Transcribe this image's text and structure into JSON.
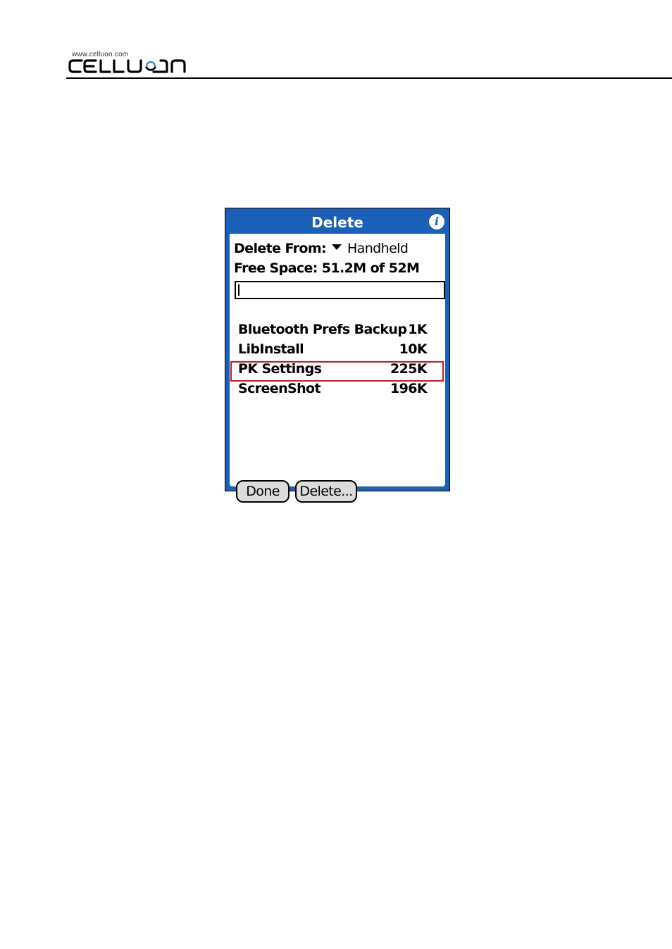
{
  "header": {
    "logo_url": "www.celluon.com",
    "logo_text": "CELLUON"
  },
  "dialog": {
    "title": "Delete",
    "delete_from_label": "Delete From:",
    "delete_from_value": "Handheld",
    "free_space": "Free Space: 51.2M of 52M",
    "search_value": "",
    "apps": [
      {
        "name": "Bluetooth Prefs Backup",
        "size": "1K"
      },
      {
        "name": "LibInstall",
        "size": "10K"
      },
      {
        "name": "PK Settings",
        "size": "225K"
      },
      {
        "name": "ScreenShot",
        "size": "196K"
      }
    ],
    "highlighted_app": "PK Settings",
    "buttons": {
      "done": "Done",
      "delete": "Delete..."
    }
  },
  "colors": {
    "title_bar": "#1a5fb8",
    "highlight": "#e0161c"
  },
  "icons": {
    "info": "info-icon",
    "dropdown": "triangle-down-icon"
  }
}
